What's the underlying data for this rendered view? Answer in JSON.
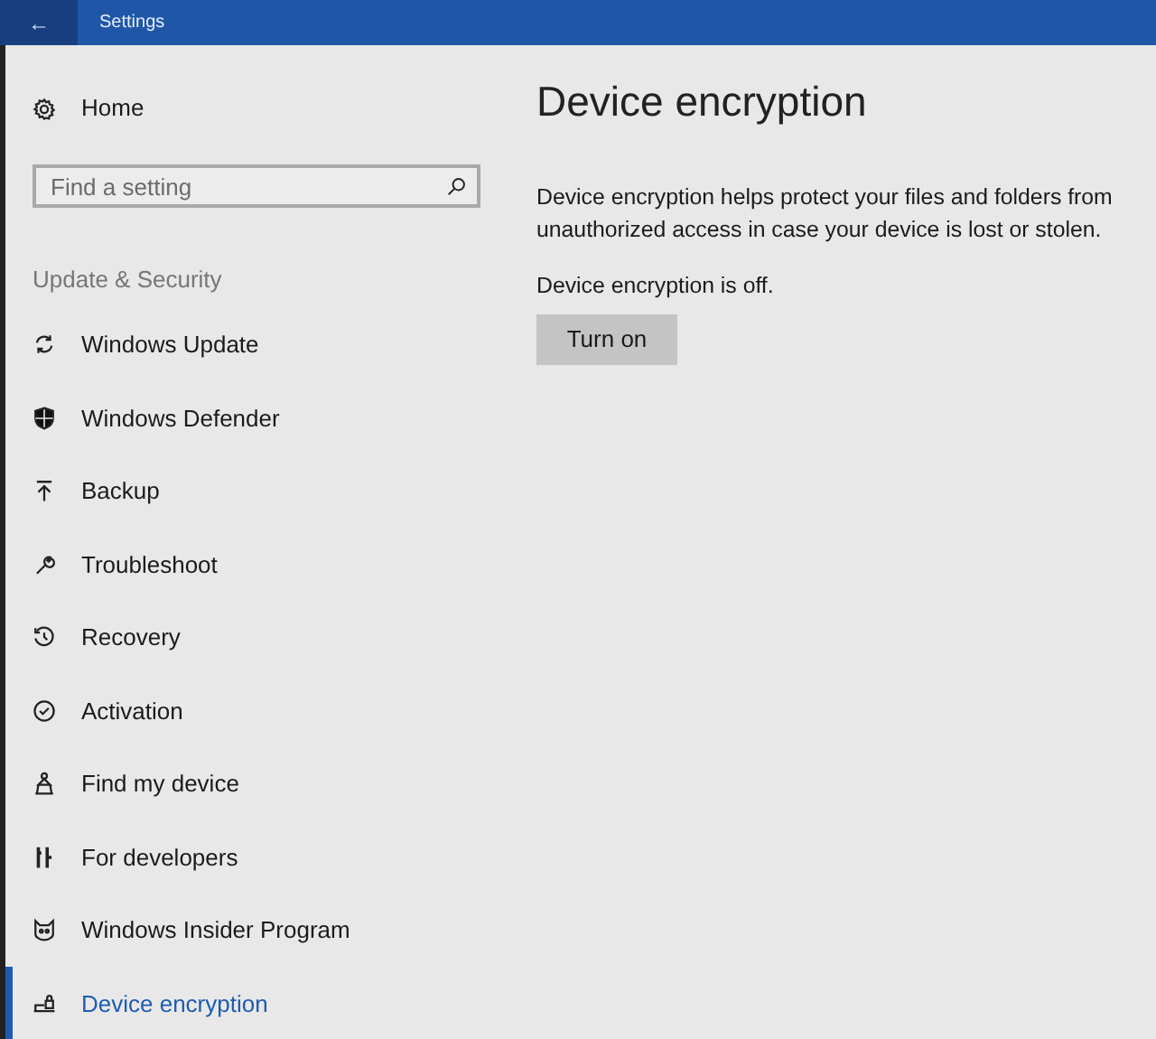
{
  "window": {
    "title": "Settings",
    "back": "←"
  },
  "sidebar": {
    "home": "Home",
    "search": {
      "placeholder": "Find a setting"
    },
    "category": "Update & Security",
    "items": [
      {
        "label": "Windows Update",
        "selected": false
      },
      {
        "label": "Windows Defender",
        "selected": false
      },
      {
        "label": "Backup",
        "selected": false
      },
      {
        "label": "Troubleshoot",
        "selected": false
      },
      {
        "label": "Recovery",
        "selected": false
      },
      {
        "label": "Activation",
        "selected": false
      },
      {
        "label": "Find my device",
        "selected": false
      },
      {
        "label": "For developers",
        "selected": false
      },
      {
        "label": "Windows Insider Program",
        "selected": false
      },
      {
        "label": "Device encryption",
        "selected": true
      }
    ]
  },
  "main": {
    "heading": "Device encryption",
    "description": "Device encryption helps protect your files and folders from unauthorized access in case your device is lost or stolen.",
    "status": "Device encryption is off.",
    "button": "Turn on"
  }
}
